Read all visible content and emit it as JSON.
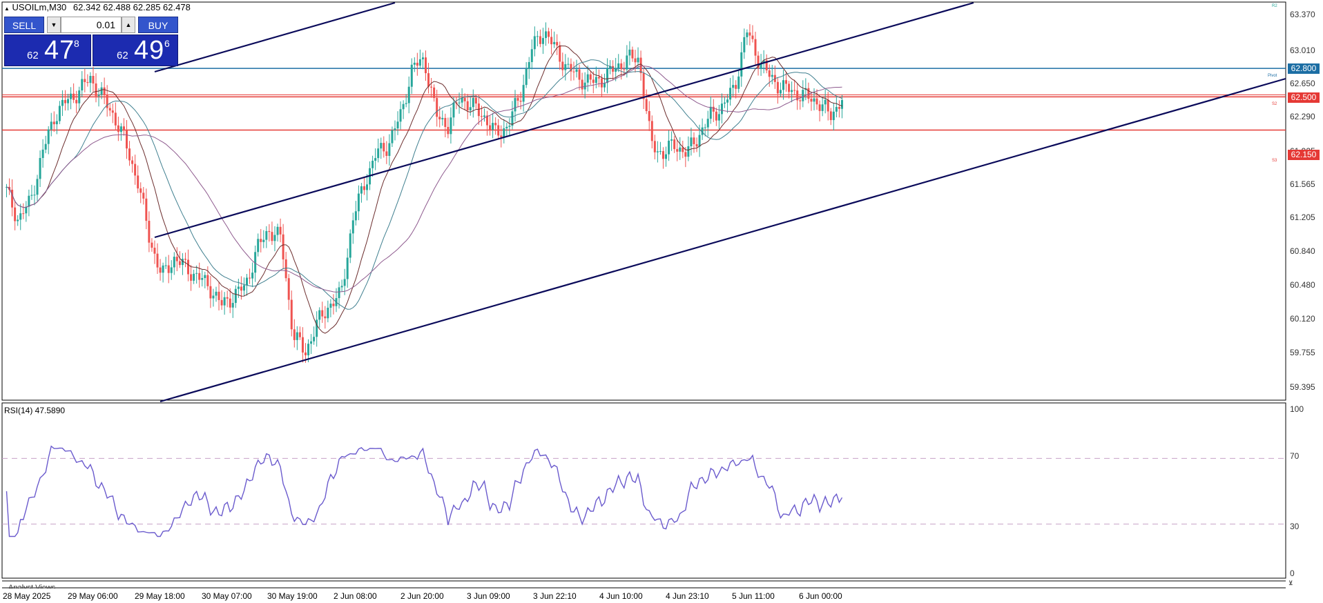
{
  "header": {
    "symbol_text": "USOILm,M30",
    "ohlc_text": "62.342 62.488 62.285 62.478"
  },
  "trade_panel": {
    "sell_label": "SELL",
    "buy_label": "BUY",
    "lot_value": "0.01",
    "sell_price": {
      "prefix": "62",
      "big": "47",
      "sup": "8"
    },
    "buy_price": {
      "prefix": "62",
      "big": "49",
      "sup": "6"
    }
  },
  "price_axis": {
    "labels": [
      "63.370",
      "63.010",
      "62.650",
      "62.290",
      "61.925",
      "61.565",
      "61.205",
      "60.840",
      "60.480",
      "60.120",
      "59.755",
      "59.395"
    ]
  },
  "levels": [
    {
      "value": 62.8,
      "label": "62.800",
      "color": "#1c6ea4",
      "tag": "Pivot"
    },
    {
      "value": 62.5,
      "label": "62.500",
      "color": "#e53935",
      "tag": "S2"
    },
    {
      "value": 62.15,
      "label": "62.150",
      "color": "#e53935",
      "tag": "S3"
    }
  ],
  "top_tag": "R2",
  "rsi": {
    "label": "RSI(14) 47.5890",
    "axis_labels": [
      "100",
      "70",
      "30",
      "0"
    ],
    "levels": [
      70,
      30
    ]
  },
  "analyst_label": "Analyst Views",
  "time_axis": {
    "labels": [
      "28 May 2025",
      "29 May 06:00",
      "29 May 18:00",
      "30 May 07:00",
      "30 May 19:00",
      "2 Jun 08:00",
      "2 Jun 20:00",
      "3 Jun 09:00",
      "3 Jun 22:10",
      "4 Jun 10:00",
      "4 Jun 23:10",
      "5 Jun 11:00",
      "6 Jun 00:00"
    ]
  },
  "colors": {
    "bull": "#26a69a",
    "bear": "#ef5350",
    "trendline": "#0a0a5a",
    "rsi_line": "#6a5acd",
    "ma_brown": "#6b2c2c",
    "ma_teal": "#3f7f8f",
    "ma_purple": "#8e5a8e",
    "panel_blue": "#1c2bb0"
  },
  "chart_data": {
    "type": "candlestick",
    "title": "USOILm,M30",
    "y_range": [
      59.3,
      63.5
    ],
    "rsi_range": [
      0,
      100
    ],
    "candles_close_path": [
      61.5,
      61.2,
      61.4,
      61.9,
      62.3,
      62.45,
      62.55,
      62.7,
      62.5,
      62.3,
      62.0,
      61.6,
      61.0,
      60.6,
      60.8,
      60.7,
      60.6,
      60.5,
      60.3,
      60.4,
      60.5,
      60.9,
      61.1,
      61.0,
      60.0,
      59.8,
      60.1,
      60.3,
      60.4,
      61.2,
      61.6,
      61.9,
      62.0,
      62.3,
      62.8,
      62.9,
      62.3,
      62.2,
      62.5,
      62.4,
      62.3,
      62.1,
      62.2,
      62.5,
      63.0,
      63.2,
      63.0,
      62.8,
      62.7,
      62.65,
      62.7,
      62.8,
      62.9,
      62.9,
      62.0,
      61.9,
      62.0,
      61.9,
      62.1,
      62.3,
      62.4,
      62.6,
      63.2,
      62.9,
      62.7,
      62.6,
      62.55,
      62.5,
      62.45,
      62.3,
      62.478
    ],
    "moving_averages": 3,
    "trendlines": 3
  }
}
